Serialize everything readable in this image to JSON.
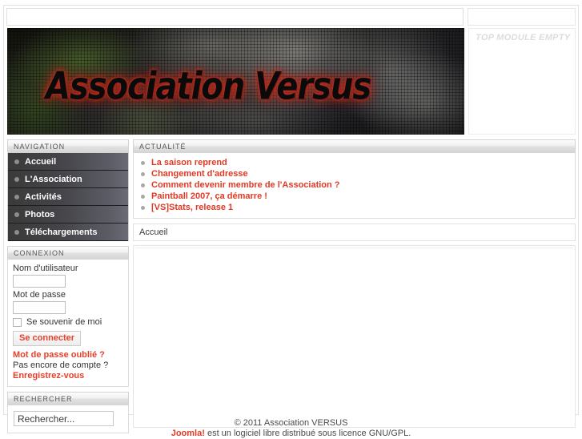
{
  "site": {
    "banner_title": "Association Versus"
  },
  "top": {
    "user_bar_value": "",
    "right_bar_value": "",
    "module_empty_label": "TOP MODULE EMPTY"
  },
  "sidebar": {
    "navigation": {
      "header": "NAVIGATION",
      "items": [
        {
          "label": "Accueil",
          "icon": "bullet-icon"
        },
        {
          "label": "L'Association",
          "icon": "bullet-icon"
        },
        {
          "label": "Activités",
          "icon": "bullet-icon"
        },
        {
          "label": "Photos",
          "icon": "bullet-icon"
        },
        {
          "label": "Téléchargements",
          "icon": "bullet-icon"
        }
      ]
    },
    "login": {
      "header": "CONNEXION",
      "username_label": "Nom d'utilisateur",
      "username_value": "",
      "password_label": "Mot de passe",
      "password_value": "",
      "remember_label": "Se souvenir de moi",
      "remember_checked": false,
      "submit_label": "Se connecter",
      "forgot_password_label": "Mot de passe oublié ?",
      "no_account_label": "Pas encore de compte ?",
      "register_label": "Enregistrez-vous"
    },
    "search": {
      "header": "RECHERCHER",
      "input_value": "Rechercher...",
      "placeholder": "Rechercher..."
    }
  },
  "main": {
    "news": {
      "header": "ACTUALITÉ",
      "items": [
        {
          "label": "La saison reprend"
        },
        {
          "label": "Changement d'adresse"
        },
        {
          "label": "Comment devenir membre de l'Association ?"
        },
        {
          "label": "Paintball 2007, ça démarre !"
        },
        {
          "label": "[VS]Stats, release 1"
        }
      ]
    },
    "breadcrumb": "Accueil",
    "article_body": ""
  },
  "footer": {
    "copyright": "© 2011 Association VERSUS",
    "joomla_name": "Joomla!",
    "license_text": " est un logiciel libre distribué sous licence GNU/GPL."
  },
  "colors": {
    "accent_red": "#e03a25",
    "nav_dark": "#46464b",
    "module_header_gray": "#e2e2e2"
  }
}
